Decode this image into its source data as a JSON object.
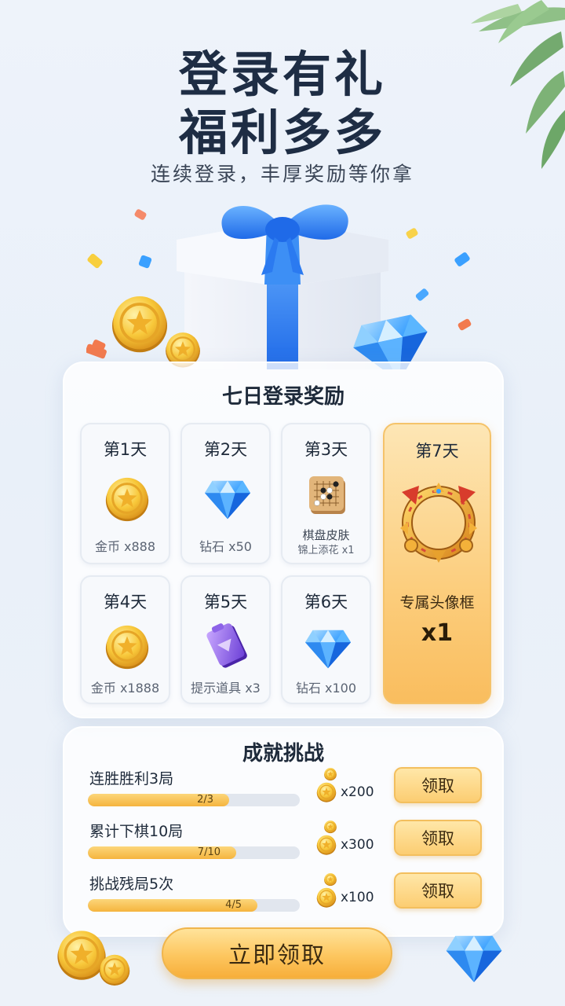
{
  "header": {
    "title_line1": "登录有礼",
    "title_line2": "福利多多",
    "subtitle": "连续登录，丰厚奖励等你拿"
  },
  "seven_day": {
    "title": "七日登录奖励",
    "days": [
      {
        "label": "第1天",
        "reward": "金币 x888",
        "icon": "gold-coin-icon"
      },
      {
        "label": "第2天",
        "reward": "钻石 x50",
        "icon": "diamond-icon"
      },
      {
        "label": "第3天",
        "reward": "棋盘皮肤",
        "reward_sub": "锦上添花 x1",
        "icon": "chessboard-skin-icon"
      },
      {
        "label": "第4天",
        "reward": "金币 x1888",
        "icon": "gold-coin-icon"
      },
      {
        "label": "第5天",
        "reward": "提示道具 x3",
        "icon": "hint-ticket-icon"
      },
      {
        "label": "第6天",
        "reward": "钻石 x100",
        "icon": "diamond-icon"
      }
    ],
    "day7": {
      "label": "第7天",
      "reward": "专属头像框",
      "count": "x1",
      "icon": "avatar-frame-icon"
    }
  },
  "achievements": {
    "title": "成就挑战",
    "claim_label": "领取",
    "items": [
      {
        "name": "连胜胜利3局",
        "progress_text": "2/3",
        "progress": 0.667,
        "reward": "x200",
        "icon": "gold-coins-icon"
      },
      {
        "name": "累计下棋10局",
        "progress_text": "7/10",
        "progress": 0.7,
        "reward": "x300",
        "icon": "gold-coins-icon"
      },
      {
        "name": "挑战残局5次",
        "progress_text": "4/5",
        "progress": 0.8,
        "reward": "x100",
        "icon": "gold-coins-icon"
      }
    ]
  },
  "main_button": {
    "label": "立即领取"
  },
  "colors": {
    "accent_gold": "#fcc968",
    "title_dark": "#1e2d44",
    "gift_blue": "#2f7ff0",
    "background": "#eef3fa"
  }
}
